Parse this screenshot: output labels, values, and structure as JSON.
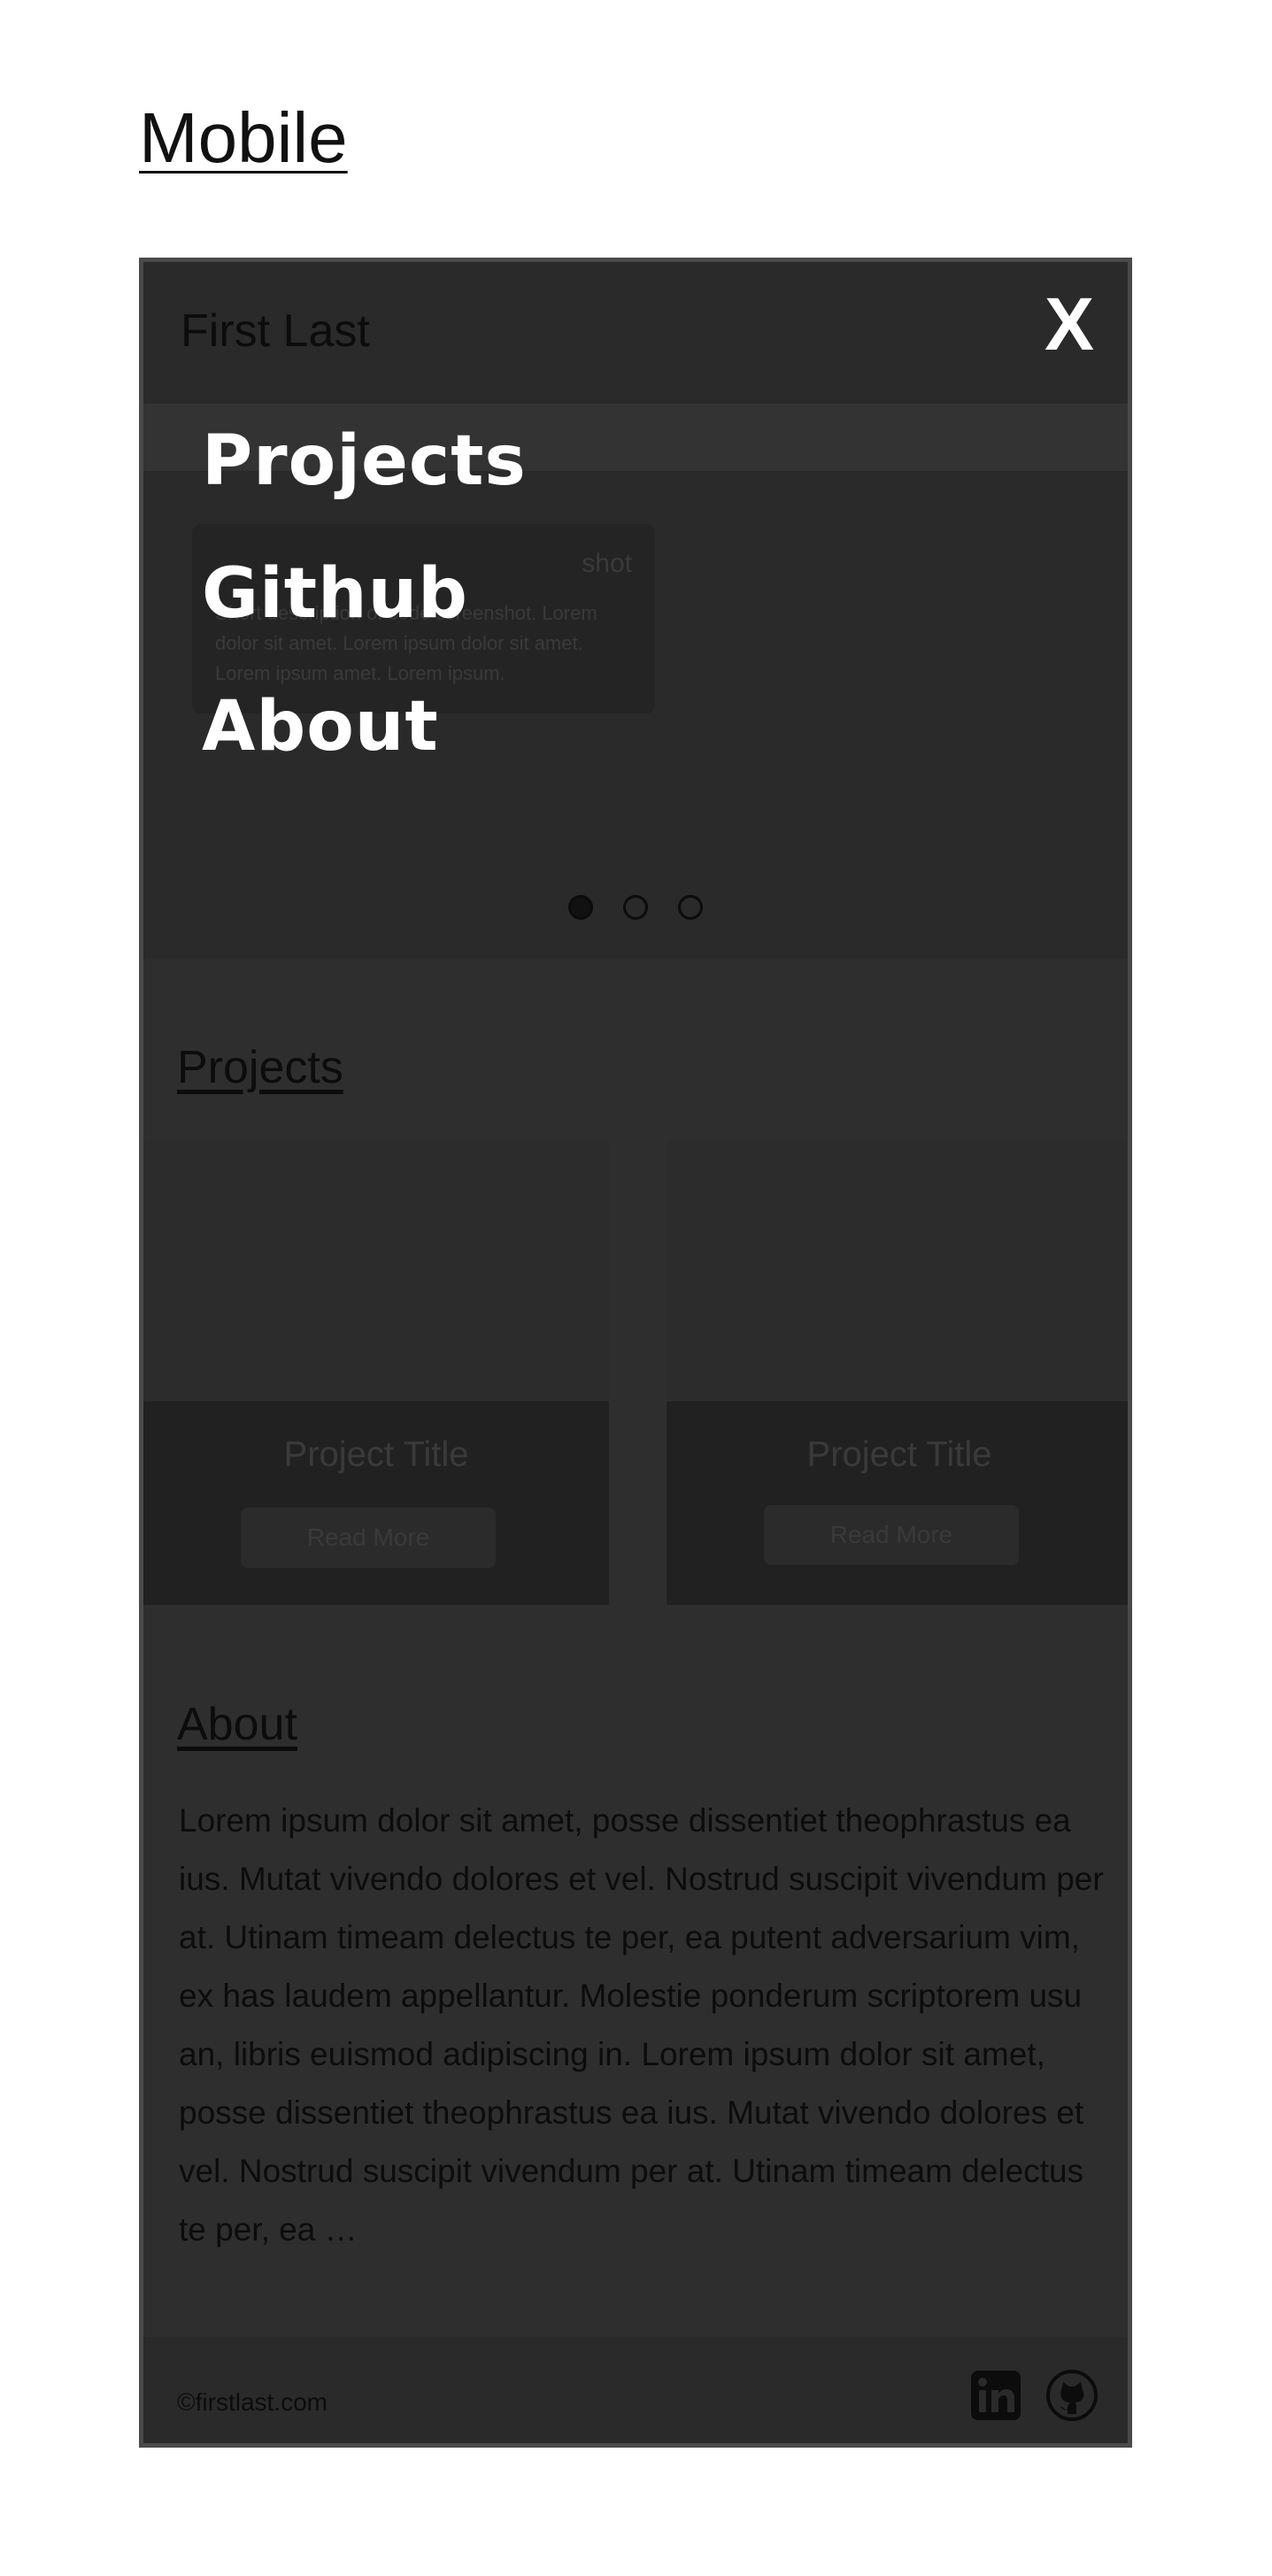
{
  "page": {
    "heading": "Mobile"
  },
  "header": {
    "brand": "First Last",
    "close_label": "X"
  },
  "nav_menu": {
    "items": [
      "Projects",
      "Github",
      "About"
    ]
  },
  "hero": {
    "card_title": "shot",
    "card_description": "Short description of code screenshot. Lorem dolor sit amet.  Lorem ipsum dolor sit amet. Lorem ipsum amet. Lorem ipsum.",
    "carousel_count": 3,
    "carousel_active": 0
  },
  "projects": {
    "title": "Projects",
    "cards": [
      {
        "title": "Project Title",
        "button": "Read More"
      },
      {
        "title": "Project Title",
        "button": "Read More"
      }
    ]
  },
  "about": {
    "title": "About",
    "text": "Lorem ipsum dolor sit amet, posse dissentiet theophrastus ea ius. Mutat vivendo dolores et vel. Nostrud suscipit vivendum per at. Utinam timeam delectus te per, ea putent adversarium vim, ex has laudem appellantur. Molestie ponderum scriptorem usu an, libris euismod adipiscing in. Lorem ipsum dolor sit amet, posse dissentiet theophrastus ea ius. Mutat vivendo dolores et vel. Nostrud suscipit vivendum per at. Utinam timeam delectus te per, ea …"
  },
  "footer": {
    "copyright": "©firstlast.com",
    "social": [
      {
        "icon": "linkedin-icon"
      },
      {
        "icon": "github-icon"
      }
    ]
  }
}
